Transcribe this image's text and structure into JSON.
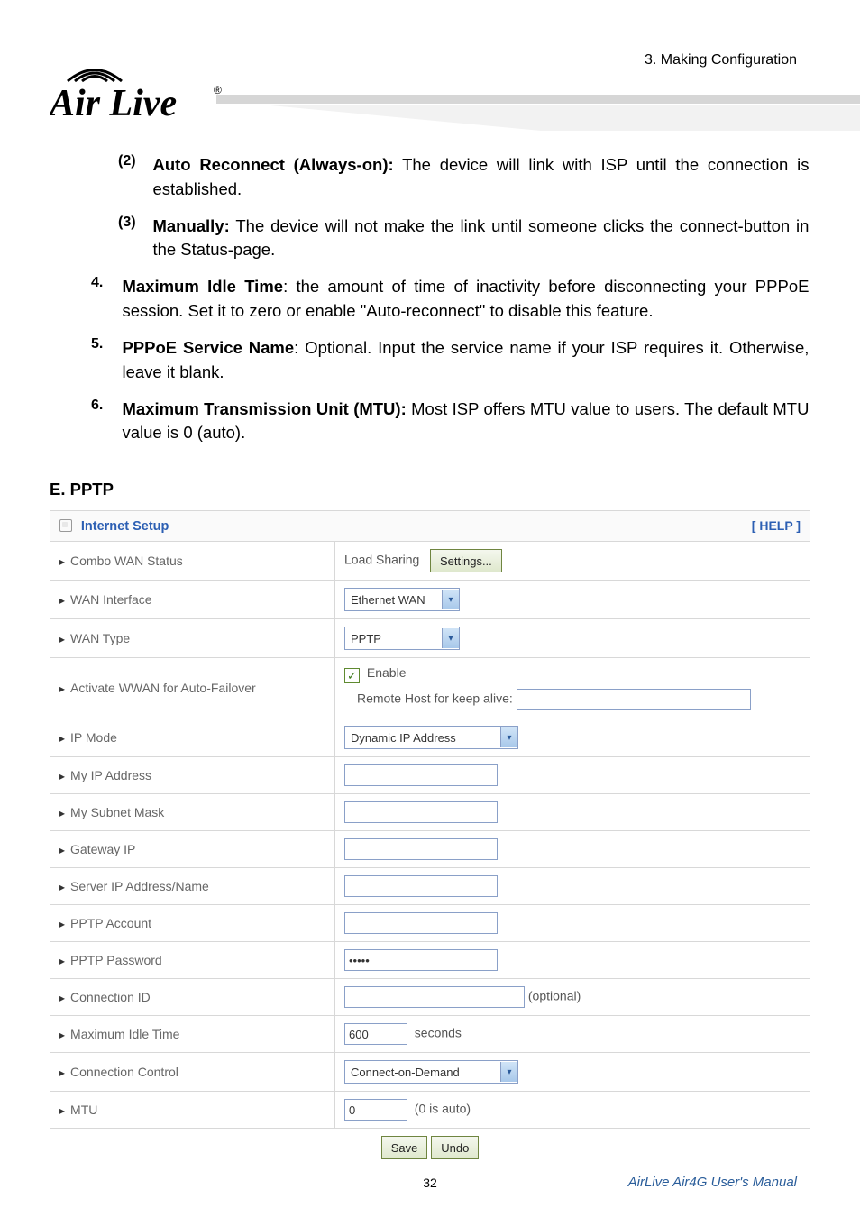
{
  "header": {
    "chapter": "3. Making Configuration",
    "logo_text": "Air Live",
    "logo_mark": "®"
  },
  "body": {
    "item2_num": "(2)",
    "item2_bold": "Auto Reconnect (Always-on):",
    "item2_rest": " The device will link with ISP until the connection is established.",
    "item3_num": "(3)",
    "item3_bold": "Manually:",
    "item3_rest": " The device will not make the link until someone clicks the connect-button in the Status-page.",
    "item4_num": "4.",
    "item4_bold": "Maximum Idle Time",
    "item4_rest": ": the amount of time of inactivity before disconnecting your PPPoE session. Set it to zero or enable \"Auto-reconnect\" to disable this feature.",
    "item5_num": "5.",
    "item5_bold": "PPPoE Service Name",
    "item5_rest": ": Optional. Input the service name if your ISP requires it. Otherwise, leave it blank.",
    "item6_num": "6.",
    "item6_bold": "Maximum Transmission Unit (MTU):",
    "item6_rest": " Most ISP offers MTU value to users. The default MTU value is 0 (auto).",
    "section_e": "E. PPTP"
  },
  "table": {
    "title": "Internet Setup",
    "help": "[ HELP ]",
    "rows": {
      "combo": "Combo WAN Status",
      "combo_mode": "Load Sharing",
      "combo_btn": "Settings...",
      "wan_if": "WAN Interface",
      "wan_if_val": "Ethernet WAN",
      "wan_type": "WAN Type",
      "wan_type_val": "PPTP",
      "activate": "Activate WWAN for Auto-Failover",
      "enable": "Enable",
      "remote_host": "Remote Host for keep alive:",
      "ip_mode": "IP Mode",
      "ip_mode_val": "Dynamic IP Address",
      "my_ip": "My IP Address",
      "my_subnet": "My Subnet Mask",
      "gateway": "Gateway IP",
      "server": "Server IP Address/Name",
      "acct": "PPTP Account",
      "pwd": "PPTP Password",
      "pwd_val": "•••••",
      "conn_id": "Connection ID",
      "optional": "(optional)",
      "max_idle": "Maximum Idle Time",
      "max_idle_val": "600",
      "seconds": "seconds",
      "conn_ctrl": "Connection Control",
      "conn_ctrl_val": "Connect-on-Demand",
      "mtu": "MTU",
      "mtu_val": "0",
      "mtu_note": "(0 is auto)",
      "save": "Save",
      "undo": "Undo"
    }
  },
  "footer": {
    "page": "32",
    "doc": "AirLive Air4G User's Manual"
  }
}
